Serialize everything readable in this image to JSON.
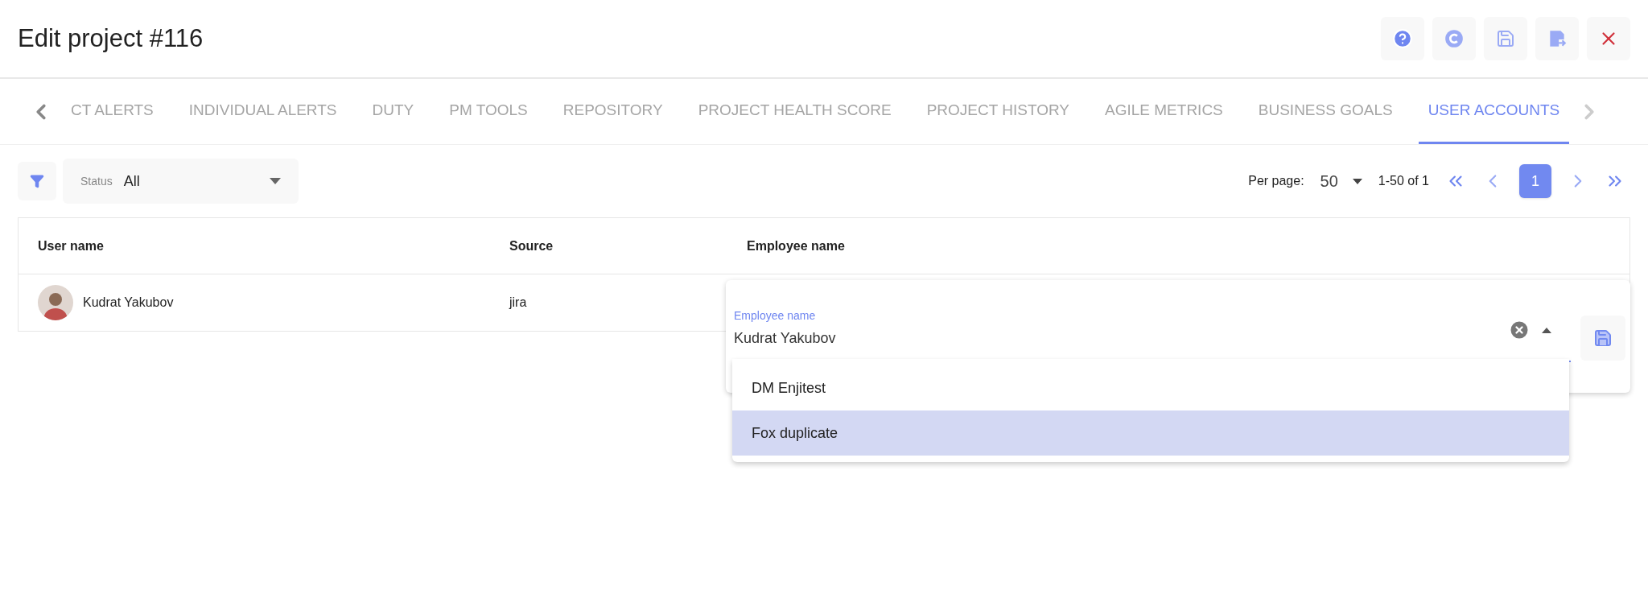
{
  "header": {
    "title": "Edit project #116",
    "actions": [
      {
        "kind": "help"
      },
      {
        "kind": "reset"
      },
      {
        "kind": "save"
      },
      {
        "kind": "save-exit"
      },
      {
        "kind": "close"
      }
    ]
  },
  "tabs": [
    {
      "label": "CT ALERTS",
      "selected": false
    },
    {
      "label": "INDIVIDUAL ALERTS",
      "selected": false
    },
    {
      "label": "DUTY",
      "selected": false
    },
    {
      "label": "PM TOOLS",
      "selected": false
    },
    {
      "label": "REPOSITORY",
      "selected": false
    },
    {
      "label": "PROJECT HEALTH SCORE",
      "selected": false
    },
    {
      "label": "PROJECT HISTORY",
      "selected": false
    },
    {
      "label": "AGILE METRICS",
      "selected": false
    },
    {
      "label": "BUSINESS GOALS",
      "selected": false
    },
    {
      "label": "USER ACCOUNTS",
      "selected": true
    }
  ],
  "filter": {
    "label": "Status",
    "value": "All"
  },
  "pagination": {
    "per_page_label": "Per page:",
    "per_page": "50",
    "range": "1-50 of 1",
    "pages": [
      {
        "label": "1",
        "selected": true
      }
    ]
  },
  "table": {
    "columns": [
      "User name",
      "Source",
      "Employee name"
    ],
    "rows": [
      {
        "user_name": "Kudrat Yakubov",
        "source": "jira"
      }
    ]
  },
  "editor": {
    "label": "Employee name",
    "value": "Kudrat Yakubov",
    "options": [
      {
        "label": "DM Enjitest",
        "selected": false
      },
      {
        "label": "Fox duplicate",
        "selected": true
      }
    ]
  }
}
